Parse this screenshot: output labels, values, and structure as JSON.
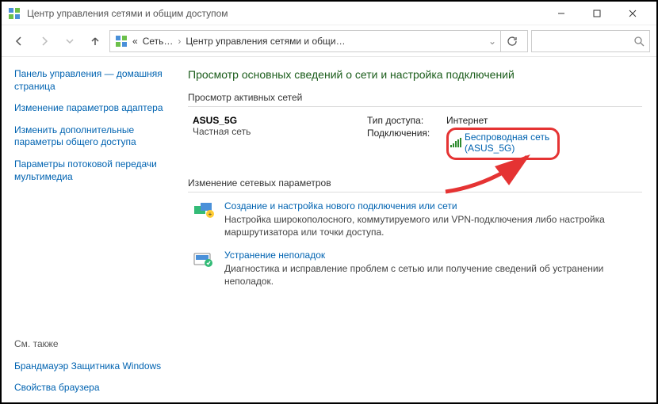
{
  "window": {
    "title": "Центр управления сетями и общим доступом"
  },
  "address": {
    "prefix": "«",
    "root": "Сеть…",
    "current": "Центр управления сетями и общи…"
  },
  "sidebar": {
    "items": [
      "Панель управления — домашняя страница",
      "Изменение параметров адаптера",
      "Изменить дополнительные параметры общего доступа",
      "Параметры потоковой передачи мультимедиа"
    ],
    "section_label": "См. также",
    "bottom": [
      "Брандмауэр Защитника Windows",
      "Свойства браузера"
    ]
  },
  "main": {
    "heading": "Просмотр основных сведений о сети и настройка подключений",
    "active_nets_label": "Просмотр активных сетей",
    "network": {
      "name": "ASUS_5G",
      "category": "Частная сеть",
      "access_label": "Тип доступа:",
      "access_value": "Интернет",
      "conn_label": "Подключения:",
      "conn_link_line1": "Беспроводная сеть",
      "conn_link_line2": "(ASUS_5G)"
    },
    "params_label": "Изменение сетевых параметров",
    "actions": [
      {
        "link": "Создание и настройка нового подключения или сети",
        "desc": "Настройка широкополосного, коммутируемого или VPN-подключения либо настройка маршрутизатора или точки доступа."
      },
      {
        "link": "Устранение неполадок",
        "desc": "Диагностика и исправление проблем с сетью или получение сведений об устранении неполадок."
      }
    ]
  }
}
